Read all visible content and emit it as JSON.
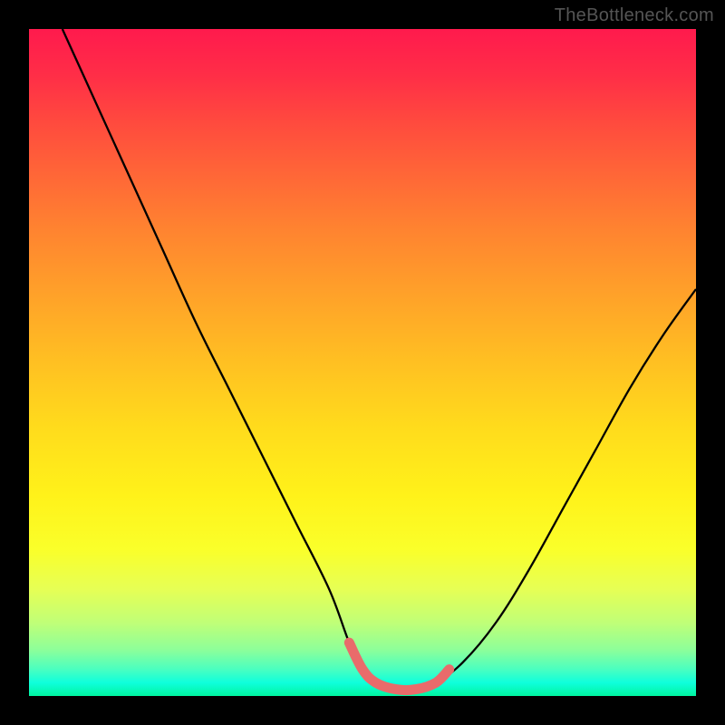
{
  "watermark": "TheBottleneck.com",
  "colors": {
    "curve": "#000000",
    "highlight": "#e96b6b",
    "background": "#000000"
  },
  "chart_data": {
    "type": "line",
    "title": "",
    "xlabel": "",
    "ylabel": "",
    "xlim": [
      0,
      100
    ],
    "ylim": [
      0,
      100
    ],
    "grid": false,
    "series": [
      {
        "name": "bottleneck-curve",
        "x": [
          5,
          10,
          15,
          20,
          25,
          30,
          35,
          40,
          45,
          48,
          50,
          52,
          55,
          58,
          61,
          65,
          70,
          75,
          80,
          85,
          90,
          95,
          100
        ],
        "y": [
          100,
          89,
          78,
          67,
          56,
          46,
          36,
          26,
          16,
          8,
          4,
          2,
          1,
          1,
          2,
          5,
          11,
          19,
          28,
          37,
          46,
          54,
          61
        ]
      }
    ],
    "highlight_range": {
      "name": "optimal-zone",
      "x": [
        48,
        50,
        52,
        55,
        58,
        61,
        63
      ],
      "y": [
        8,
        4,
        2,
        1,
        1,
        2,
        4
      ]
    }
  }
}
